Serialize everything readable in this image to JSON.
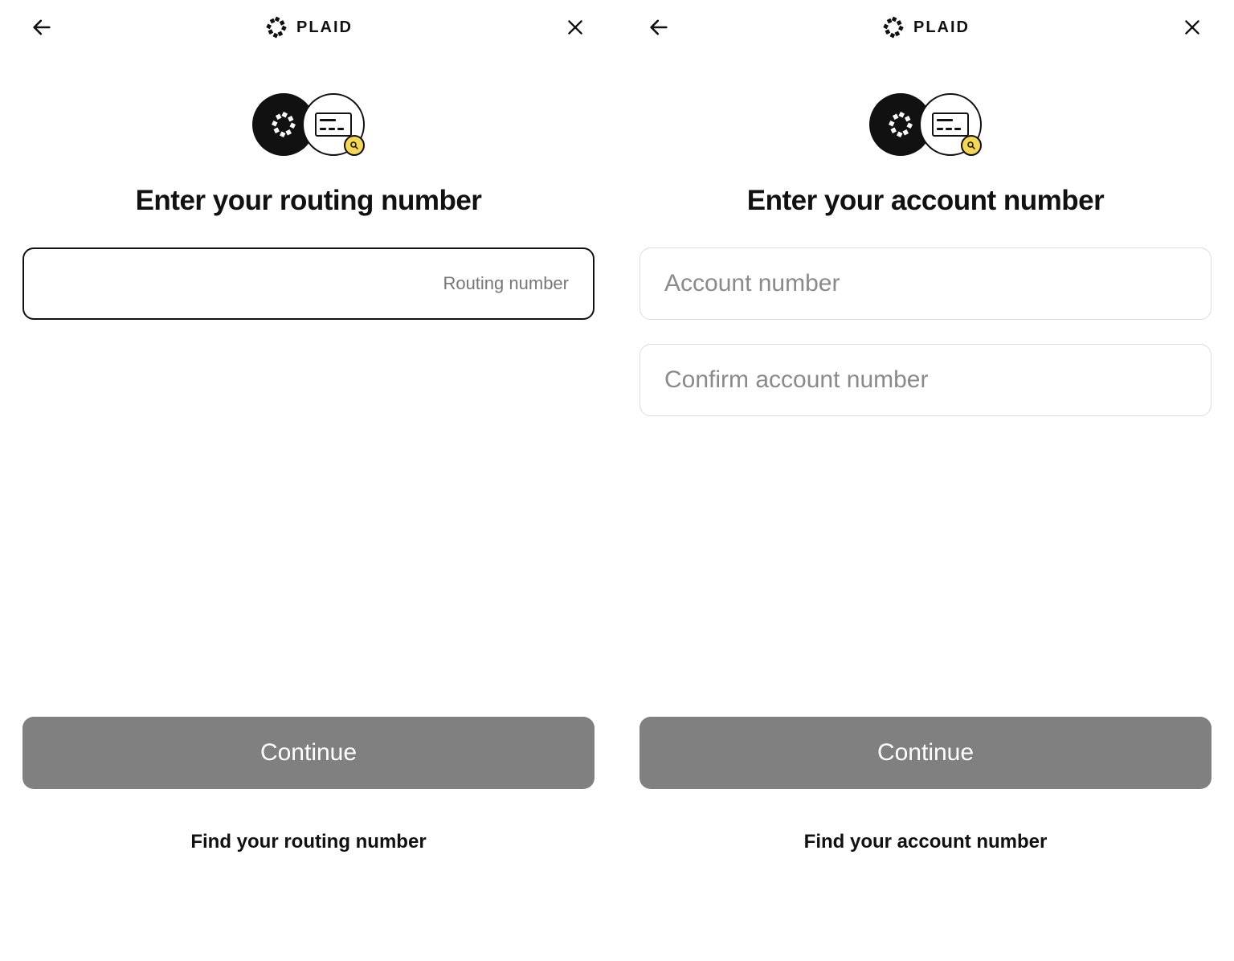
{
  "brand": "PLAID",
  "left": {
    "title": "Enter your routing number",
    "routing_placeholder": "Routing number",
    "continue_label": "Continue",
    "find_label": "Find your routing number"
  },
  "right": {
    "title": "Enter your account number",
    "account_placeholder": "Account number",
    "confirm_placeholder": "Confirm account number",
    "continue_label": "Continue",
    "find_label": "Find your account number"
  }
}
